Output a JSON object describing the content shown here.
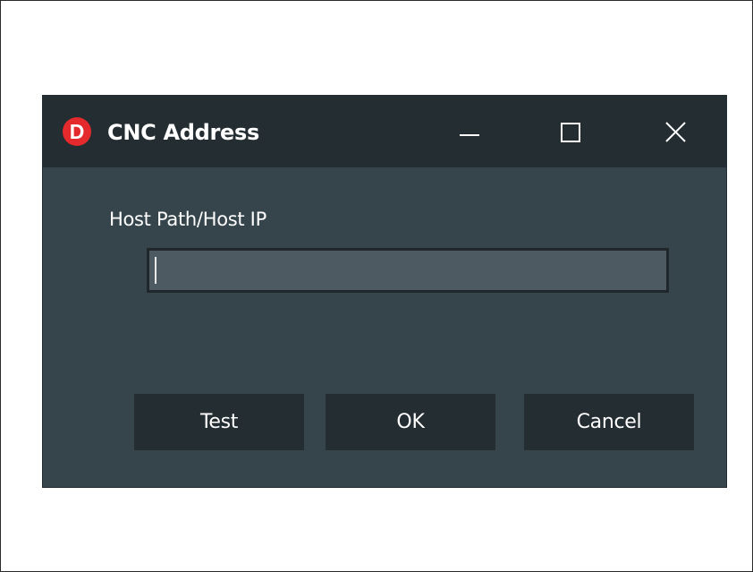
{
  "window": {
    "title": "CNC Address",
    "icon": "D",
    "controls": [
      "minimize-icon",
      "maximize-icon",
      "close-icon"
    ]
  },
  "form": {
    "label": "Host Path/Host IP",
    "value": "",
    "placeholder": ""
  },
  "buttons": {
    "test": "Test",
    "ok": "OK",
    "cancel": "Cancel"
  },
  "colors": {
    "dialog_bg": "#36454c",
    "titlebar_bg": "#242d32",
    "input_bg": "#4d5a61",
    "icon_red": "#e42a2c"
  }
}
